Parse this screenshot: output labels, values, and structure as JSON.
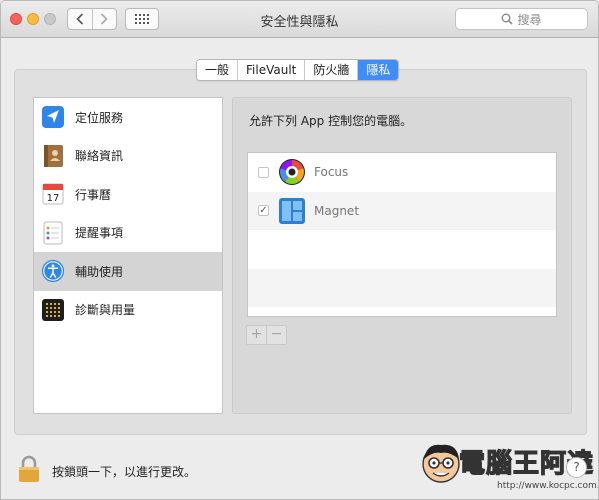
{
  "window": {
    "title": "安全性與隱私",
    "search_placeholder": "搜尋"
  },
  "tabs": [
    {
      "label": "一般",
      "active": false
    },
    {
      "label": "FileVault",
      "active": false
    },
    {
      "label": "防火牆",
      "active": false
    },
    {
      "label": "隱私",
      "active": true
    }
  ],
  "sidebar": {
    "items": [
      {
        "label": "定位服務",
        "icon": "location-arrow-icon",
        "selected": false
      },
      {
        "label": "聯絡資訊",
        "icon": "contacts-book-icon",
        "selected": false
      },
      {
        "label": "行事曆",
        "icon": "calendar-icon",
        "selected": false
      },
      {
        "label": "提醒事項",
        "icon": "reminders-list-icon",
        "selected": false
      },
      {
        "label": "輔助使用",
        "icon": "accessibility-icon",
        "selected": true
      },
      {
        "label": "診斷與用量",
        "icon": "diagnostics-grid-icon",
        "selected": false
      }
    ]
  },
  "panel": {
    "label": "允許下列 App 控制您的電腦。",
    "apps": [
      {
        "name": "Focus",
        "checked": false,
        "icon": "focus-app-icon"
      },
      {
        "name": "Magnet",
        "checked": true,
        "icon": "magnet-app-icon"
      }
    ],
    "add_label": "+",
    "remove_label": "−"
  },
  "footer": {
    "lock_text": "按鎖頭一下，以進行更改。",
    "help_label": "?"
  },
  "watermark": {
    "text": "電腦王阿達",
    "url": "http://www.kocpc.com.tw"
  },
  "colors": {
    "accent": "#3f8dfb",
    "selected_row": "#d4d4d4"
  }
}
